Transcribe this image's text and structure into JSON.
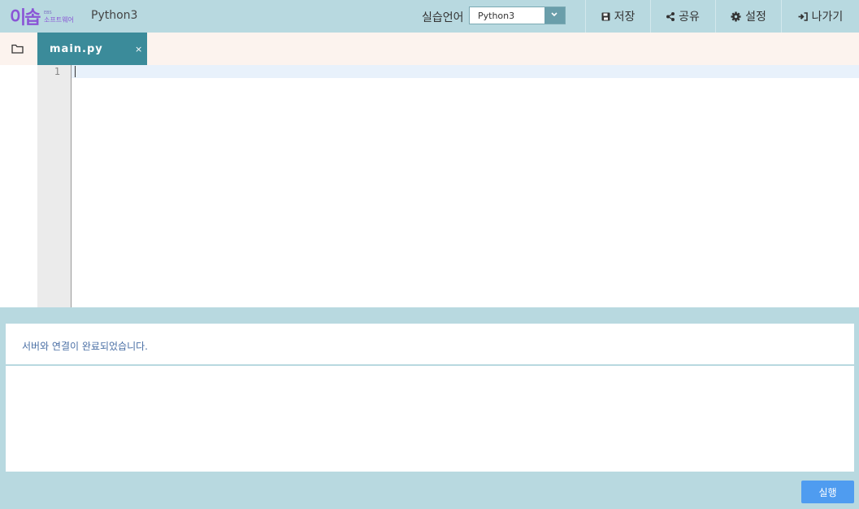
{
  "header": {
    "logo_main": "이솝",
    "logo_small": "EBS",
    "logo_sub": "소프트웨어",
    "app_title": "Python3",
    "lang_label": "실습언어",
    "lang_value": "Python3",
    "buttons": {
      "save": "저장",
      "share": "공유",
      "settings": "설정",
      "exit": "나가기"
    }
  },
  "editor": {
    "tab_label": "main.py",
    "tab_close": "×",
    "line_numbers": [
      "1"
    ]
  },
  "console": {
    "message": "서버와 연결이 완료되었습니다.",
    "output": ""
  },
  "run_button": "실행",
  "colors": {
    "header_bg": "#b8d9e0",
    "tab_active": "#3b8b9a",
    "run_button": "#4f9cf0",
    "console_text": "#4a6fa5"
  },
  "icons": {
    "save": "floppy-icon",
    "share": "share-icon",
    "settings": "gear-icon",
    "exit": "sign-out-icon",
    "folder": "folder-icon",
    "dropdown": "chevron-down-icon"
  }
}
